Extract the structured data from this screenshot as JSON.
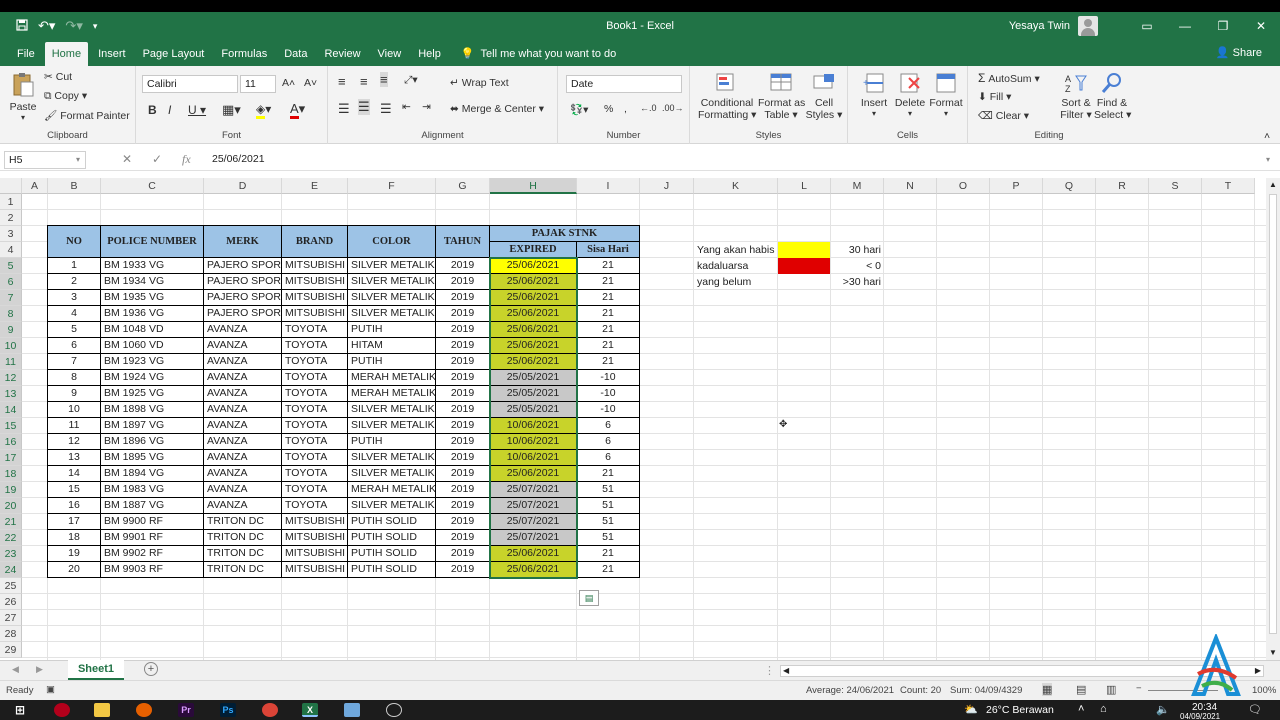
{
  "window": {
    "title": "Book1  -  Excel",
    "user": "Yesaya Twin"
  },
  "tabs": [
    "File",
    "Home",
    "Insert",
    "Page Layout",
    "Formulas",
    "Data",
    "Review",
    "View",
    "Help"
  ],
  "tell_me": "Tell me what you want to do",
  "share": "Share",
  "ribbon": {
    "clipboard": {
      "label": "Clipboard",
      "paste": "Paste",
      "cut": "Cut",
      "copy": "Copy",
      "format_painter": "Format Painter"
    },
    "font": {
      "label": "Font",
      "font_name": "Calibri",
      "font_size": "11"
    },
    "alignment": {
      "label": "Alignment",
      "wrap_text": "Wrap Text",
      "merge_center": "Merge & Center"
    },
    "number": {
      "label": "Number",
      "format": "Date"
    },
    "styles": {
      "label": "Styles",
      "conditional": "Conditional",
      "formatting": "Formatting",
      "format_as": "Format as",
      "table": "Table",
      "cell": "Cell",
      "cell_styles": "Styles"
    },
    "cells": {
      "label": "Cells",
      "insert": "Insert",
      "delete": "Delete",
      "format": "Format"
    },
    "editing": {
      "label": "Editing",
      "autosum": "AutoSum",
      "fill": "Fill",
      "clear": "Clear",
      "sort": "Sort &",
      "filter": "Filter",
      "find": "Find &",
      "select": "Select"
    }
  },
  "formula_bar": {
    "name_box": "H5",
    "value": "25/06/2021"
  },
  "columns": [
    "A",
    "B",
    "C",
    "D",
    "E",
    "F",
    "G",
    "H",
    "I",
    "J",
    "K",
    "L",
    "M",
    "N",
    "O",
    "P",
    "Q",
    "R",
    "S",
    "T"
  ],
  "rows": [
    "1",
    "2",
    "3",
    "4",
    "5",
    "6",
    "7",
    "8",
    "9",
    "10",
    "11",
    "12",
    "13",
    "14",
    "15",
    "16",
    "17",
    "18",
    "19",
    "20",
    "21",
    "22",
    "23",
    "24",
    "25",
    "26",
    "27",
    "28",
    "29"
  ],
  "table": {
    "headers": {
      "no": "NO",
      "police": "POLICE NUMBER",
      "merk": "MERK",
      "brand": "BRAND",
      "color": "COLOR",
      "tahun": "TAHUN",
      "pajak": "PAJAK STNK",
      "expired": "EXPIRED",
      "sisa": "Sisa Hari"
    },
    "rows": [
      {
        "no": "1",
        "police": "BM 1933 VG",
        "merk": "PAJERO SPORT",
        "brand": "MITSUBISHI",
        "color": "SILVER METALIK",
        "tahun": "2019",
        "expired": "25/06/2021",
        "sisa": "21",
        "fill": "#ffff00"
      },
      {
        "no": "2",
        "police": "BM 1934 VG",
        "merk": "PAJERO SPORT",
        "brand": "MITSUBISHI",
        "color": "SILVER METALIK",
        "tahun": "2019",
        "expired": "25/06/2021",
        "sisa": "21",
        "fill": "#c8d32a"
      },
      {
        "no": "3",
        "police": "BM 1935 VG",
        "merk": "PAJERO SPORT",
        "brand": "MITSUBISHI",
        "color": "SILVER METALIK",
        "tahun": "2019",
        "expired": "25/06/2021",
        "sisa": "21",
        "fill": "#c8d32a"
      },
      {
        "no": "4",
        "police": "BM 1936 VG",
        "merk": "PAJERO SPORT",
        "brand": "MITSUBISHI",
        "color": "SILVER METALIK",
        "tahun": "2019",
        "expired": "25/06/2021",
        "sisa": "21",
        "fill": "#c8d32a"
      },
      {
        "no": "5",
        "police": "BM 1048 VD",
        "merk": "AVANZA",
        "brand": "TOYOTA",
        "color": "PUTIH",
        "tahun": "2019",
        "expired": "25/06/2021",
        "sisa": "21",
        "fill": "#c8d32a"
      },
      {
        "no": "6",
        "police": "BM 1060 VD",
        "merk": "AVANZA",
        "brand": "TOYOTA",
        "color": "HITAM",
        "tahun": "2019",
        "expired": "25/06/2021",
        "sisa": "21",
        "fill": "#c8d32a"
      },
      {
        "no": "7",
        "police": "BM 1923 VG",
        "merk": "AVANZA",
        "brand": "TOYOTA",
        "color": "PUTIH",
        "tahun": "2019",
        "expired": "25/06/2021",
        "sisa": "21",
        "fill": "#c8d32a"
      },
      {
        "no": "8",
        "police": "BM 1924 VG",
        "merk": "AVANZA",
        "brand": "TOYOTA",
        "color": "MERAH METALIK",
        "tahun": "2019",
        "expired": "25/05/2021",
        "sisa": "-10",
        "fill": "#c8c8c8"
      },
      {
        "no": "9",
        "police": "BM 1925 VG",
        "merk": "AVANZA",
        "brand": "TOYOTA",
        "color": "MERAH METALIK",
        "tahun": "2019",
        "expired": "25/05/2021",
        "sisa": "-10",
        "fill": "#c8c8c8"
      },
      {
        "no": "10",
        "police": "BM 1898 VG",
        "merk": "AVANZA",
        "brand": "TOYOTA",
        "color": "SILVER METALIK",
        "tahun": "2019",
        "expired": "25/05/2021",
        "sisa": "-10",
        "fill": "#c8c8c8"
      },
      {
        "no": "11",
        "police": "BM 1897 VG",
        "merk": "AVANZA",
        "brand": "TOYOTA",
        "color": "SILVER METALIK",
        "tahun": "2019",
        "expired": "10/06/2021",
        "sisa": "6",
        "fill": "#c8d32a"
      },
      {
        "no": "12",
        "police": "BM 1896 VG",
        "merk": "AVANZA",
        "brand": "TOYOTA",
        "color": "PUTIH",
        "tahun": "2019",
        "expired": "10/06/2021",
        "sisa": "6",
        "fill": "#c8d32a"
      },
      {
        "no": "13",
        "police": "BM 1895 VG",
        "merk": "AVANZA",
        "brand": "TOYOTA",
        "color": "SILVER METALIK",
        "tahun": "2019",
        "expired": "10/06/2021",
        "sisa": "6",
        "fill": "#c8d32a"
      },
      {
        "no": "14",
        "police": "BM 1894 VG",
        "merk": "AVANZA",
        "brand": "TOYOTA",
        "color": "SILVER METALIK",
        "tahun": "2019",
        "expired": "25/06/2021",
        "sisa": "21",
        "fill": "#c8d32a"
      },
      {
        "no": "15",
        "police": "BM 1983 VG",
        "merk": "AVANZA",
        "brand": "TOYOTA",
        "color": "MERAH METALIK",
        "tahun": "2019",
        "expired": "25/07/2021",
        "sisa": "51",
        "fill": "#c8c8c8"
      },
      {
        "no": "16",
        "police": "BM 1887 VG",
        "merk": "AVANZA",
        "brand": "TOYOTA",
        "color": "SILVER METALIK",
        "tahun": "2019",
        "expired": "25/07/2021",
        "sisa": "51",
        "fill": "#c8c8c8"
      },
      {
        "no": "17",
        "police": "BM 9900 RF",
        "merk": "TRITON DC",
        "brand": "MITSUBISHI",
        "color": "PUTIH SOLID",
        "tahun": "2019",
        "expired": "25/07/2021",
        "sisa": "51",
        "fill": "#c8c8c8"
      },
      {
        "no": "18",
        "police": "BM 9901 RF",
        "merk": "TRITON DC",
        "brand": "MITSUBISHI",
        "color": "PUTIH SOLID",
        "tahun": "2019",
        "expired": "25/07/2021",
        "sisa": "51",
        "fill": "#c8c8c8"
      },
      {
        "no": "19",
        "police": "BM 9902 RF",
        "merk": "TRITON DC",
        "brand": "MITSUBISHI",
        "color": "PUTIH SOLID",
        "tahun": "2019",
        "expired": "25/06/2021",
        "sisa": "21",
        "fill": "#c8d32a"
      },
      {
        "no": "20",
        "police": "BM 9903 RF",
        "merk": "TRITON DC",
        "brand": "MITSUBISHI",
        "color": "PUTIH SOLID",
        "tahun": "2019",
        "expired": "25/06/2021",
        "sisa": "21",
        "fill": "#c8d32a"
      }
    ]
  },
  "legend": [
    {
      "label": "Yang akan habis",
      "color": "#ffff00",
      "value": "30 hari"
    },
    {
      "label": "kadaluarsa",
      "color": "#e00000",
      "value": "< 0"
    },
    {
      "label": "yang belum",
      "color": "",
      "value": ">30 hari"
    }
  ],
  "sheet": {
    "tab": "Sheet1"
  },
  "status": {
    "ready": "Ready",
    "average": "Average: 24/06/2021",
    "count": "Count: 20",
    "sum": "Sum: 04/09/4329",
    "zoom": "100%"
  },
  "taskbar": {
    "weather": "26°C  Berawan",
    "time": "20:34",
    "date": "04/09/2021"
  },
  "colors": {
    "excel_green": "#217346",
    "header_blue": "#9dc3e6",
    "yellow": "#ffff00",
    "yellow_green": "#c8d32a",
    "gray": "#c8c8c8",
    "red": "#e00000"
  }
}
